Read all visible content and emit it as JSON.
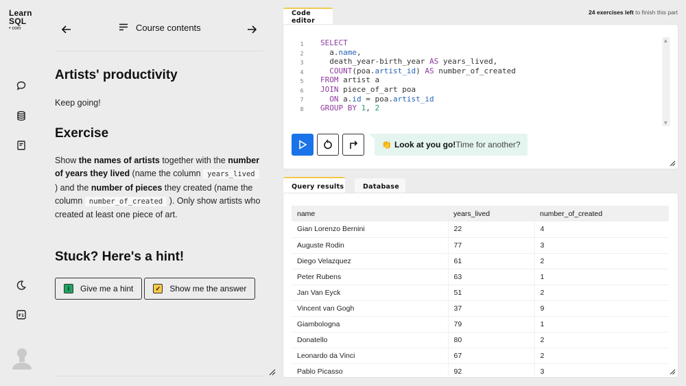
{
  "logo": {
    "line1": "Learn",
    "line2": "SQL",
    "line3": "• com"
  },
  "rail": {
    "icons": [
      "chat-icon",
      "database-icon",
      "notes-icon",
      "dark-mode-icon",
      "keyboard-shortcut-icon",
      "avatar"
    ],
    "shortcut_key": "F1"
  },
  "course_nav": {
    "contents_label": "Course contents",
    "prev_icon": "arrow-left-icon",
    "next_icon": "arrow-right-icon"
  },
  "lesson": {
    "title": "Artists' productivity",
    "subtitle": "Keep going!",
    "exercise_heading": "Exercise",
    "exercise_parts": {
      "p1": "Show ",
      "b1": "the names of artists",
      "p2": " together with the ",
      "b2": "number of years they lived",
      "p3": " (name the column ",
      "c1": "years_lived",
      "p4": " ) and the ",
      "b3": "number of pieces",
      "p5": " they created (name the column ",
      "c2": "number_of_created",
      "p6": " ). Only show artists who created at least one piece of art."
    },
    "hint_heading": "Stuck? Here's a hint!",
    "hint_button": "Give me a hint",
    "answer_button": "Show me the answer"
  },
  "header_note": {
    "bold": "24 exercises left",
    "rest": " to finish this part"
  },
  "editor": {
    "tab_label": "Code editor",
    "line_numbers": [
      "1",
      "2",
      "3",
      "4",
      "5",
      "6",
      "7",
      "8"
    ],
    "code_lines": [
      [
        {
          "t": "SELECT",
          "c": "kw"
        }
      ],
      [
        {
          "t": "  a.",
          "c": ""
        },
        {
          "t": "name",
          "c": "prop"
        },
        {
          "t": ",",
          "c": ""
        }
      ],
      [
        {
          "t": "  death_year-birth_year ",
          "c": ""
        },
        {
          "t": "AS",
          "c": "kw"
        },
        {
          "t": " years_lived,",
          "c": ""
        }
      ],
      [
        {
          "t": "  ",
          "c": ""
        },
        {
          "t": "COUNT",
          "c": "kw"
        },
        {
          "t": "(poa.",
          "c": ""
        },
        {
          "t": "artist_id",
          "c": "prop"
        },
        {
          "t": ") ",
          "c": ""
        },
        {
          "t": "AS",
          "c": "kw"
        },
        {
          "t": " number_of_created",
          "c": ""
        }
      ],
      [
        {
          "t": "FROM",
          "c": "kw"
        },
        {
          "t": " artist a",
          "c": ""
        }
      ],
      [
        {
          "t": "JOIN",
          "c": "kw"
        },
        {
          "t": " piece_of_art poa",
          "c": ""
        }
      ],
      [
        {
          "t": "  ",
          "c": ""
        },
        {
          "t": "ON",
          "c": "kw"
        },
        {
          "t": " a.",
          "c": ""
        },
        {
          "t": "id",
          "c": "prop"
        },
        {
          "t": " = poa.",
          "c": ""
        },
        {
          "t": "artist_id",
          "c": "prop"
        }
      ],
      [
        {
          "t": "GROUP BY",
          "c": "kw"
        },
        {
          "t": " ",
          "c": ""
        },
        {
          "t": "1",
          "c": "num"
        },
        {
          "t": ", ",
          "c": ""
        },
        {
          "t": "2",
          "c": "num"
        }
      ]
    ],
    "feedback_bold": "Look at you go!",
    "feedback_rest": " Time for another?",
    "feedback_emoji": "👏"
  },
  "results": {
    "tabs": [
      "Query results",
      "Database"
    ],
    "columns": [
      "name",
      "years_lived",
      "number_of_created"
    ],
    "rows": [
      [
        "Gian Lorenzo Bernini",
        "22",
        "4"
      ],
      [
        "Auguste Rodin",
        "77",
        "3"
      ],
      [
        "Diego Velazquez",
        "61",
        "2"
      ],
      [
        "Peter Rubens",
        "63",
        "1"
      ],
      [
        "Jan Van Eyck",
        "51",
        "2"
      ],
      [
        "Vincent van Gogh",
        "37",
        "9"
      ],
      [
        "Giambologna",
        "79",
        "1"
      ],
      [
        "Donatello",
        "80",
        "2"
      ],
      [
        "Leonardo da Vinci",
        "67",
        "2"
      ],
      [
        "Pablo Picasso",
        "92",
        "3"
      ]
    ]
  },
  "colors": {
    "run_button": "#1a73e8",
    "tab_accent": "#f1c84b",
    "feedback_bg": "#e4f5ef",
    "hint_icon": "#1fa463",
    "answer_icon": "#f7c948",
    "keyword": "#8e3a9e",
    "property": "#2563b8",
    "number": "#1a9a6b"
  }
}
